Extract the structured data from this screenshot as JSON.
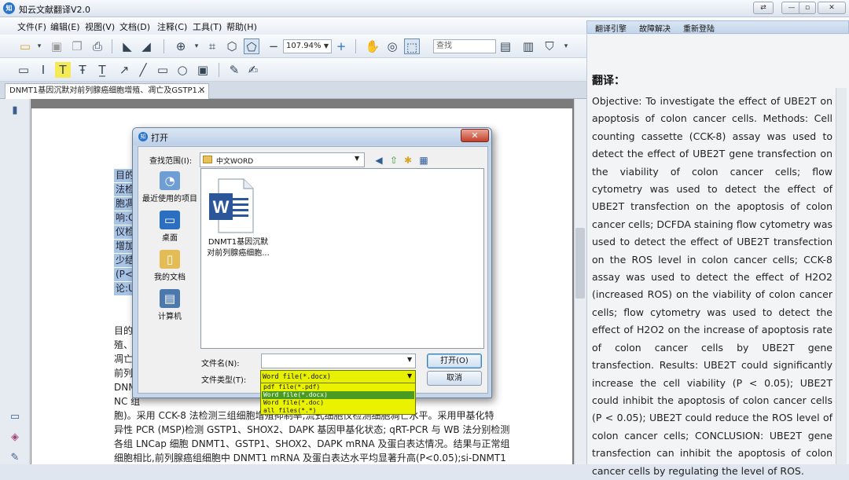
{
  "window": {
    "title": "知云文献翻译V2.0",
    "logo_text": "知",
    "controls": [
      "restore-icon",
      "minimize-icon",
      "maximize-icon",
      "close-icon"
    ]
  },
  "menu": [
    "文件(F)",
    "编辑(E)",
    "视图(V)",
    "文档(D)",
    "注释(C)",
    "工具(T)",
    "帮助(H)"
  ],
  "translation_links": [
    "翻译引擎",
    "故障解决",
    "重新登陆"
  ],
  "toolbar": {
    "zoom": "107.94%",
    "search_placeholder": "查找"
  },
  "tab": {
    "title": "DNMT1基因沉默对前列腺癌细胞增殖、凋亡及GSTP1...",
    "close": "✕"
  },
  "document": {
    "highlighted": [
      "目的",
      "法检",
      "胞凋",
      "响:C",
      "仪检",
      "增加",
      "少结",
      "(P<0",
      "论:U"
    ],
    "body": [
      "目的",
      "殖、",
      "凋亡",
      "前列",
      "DNM",
      "NC 组",
      "胞)。采用 CCK-8 法检测三组细胞增殖抑制率,流式细胞仪检测细胞凋亡水平。采用甲基化特",
      "异性 PCR (MSP)检测 GSTP1、SHOX2、DAPK 基因甲基化状态; qRT-PCR 与 WB 法分别检测",
      "各组 LNCap 细胞 DNMT1、GSTP1、SHOX2、DAPK mRNA 及蛋白表达情况。结果与正常组",
      "细胞相比,前列腺癌组细胞中 DNMT1 mRNA 及蛋白表达水平均显著升高(P<0.05);si-DNMT1"
    ]
  },
  "translation": {
    "heading": "翻译：",
    "text": "Objective: To investigate the effect of UBE2T on apoptosis of colon cancer cells. Methods: Cell counting cassette (CCK-8) assay was used to detect the effect of UBE2T gene transfection on the viability of colon cancer cells; flow cytometry was used to detect the effect of UBE2T transfection on the apoptosis of colon cancer cells; DCFDA staining flow cytometry was used to detect the effect of UBE2T transfection on the ROS level in colon cancer cells; CCK-8 assay was used to detect the effect of H2O2 (increased ROS) on the viability of colon cancer cells; flow cytometry was used to detect the effect of H2O2 on the increase of apoptosis rate of colon cancer cells by UBE2T gene transfection. Results: UBE2T could significantly increase the cell viability (P < 0.05); UBE2T could inhibit the apoptosis of colon cancer cells (P < 0.05); UBE2T could reduce the ROS level of colon cancer cells; CONCLUSION: UBE2T gene transfection can inhibit the apoptosis of colon cancer cells by regulating the level of ROS."
  },
  "dialog": {
    "title": "打开",
    "close": "✕",
    "look_in_label": "查找范围(I):",
    "look_in_value": "中文WORD",
    "places": [
      {
        "label": "最近使用的项目",
        "icon": "recent-items-icon"
      },
      {
        "label": "桌面",
        "icon": "desktop-icon"
      },
      {
        "label": "我的文档",
        "icon": "my-documents-icon"
      },
      {
        "label": "计算机",
        "icon": "computer-icon"
      }
    ],
    "file": {
      "name_line1": "DNMT1基因沉默",
      "name_line2": "对前列腺癌细胞..."
    },
    "file_name_label": "文件名(N):",
    "file_name_value": "",
    "file_type_label": "文件类型(T):",
    "file_type_value": "Word file(*.docx)",
    "file_type_options": [
      "pdf file(*.pdf)",
      "Word file(*.docx)",
      "Word file(*.doc)",
      "all files(*.*)"
    ],
    "file_type_selected_index": 1,
    "open_button": "打开(O)",
    "cancel_button": "取消"
  }
}
